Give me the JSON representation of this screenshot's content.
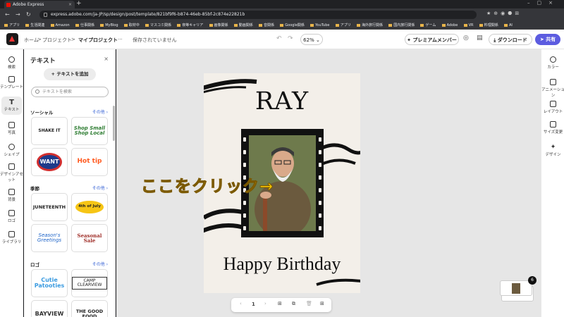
{
  "browser": {
    "tab_title": "Adobe Express",
    "url": "express.adobe.com/ja-JP/sp/design/post/template/821bf9f6-b874-46eb-85bf-2c874e22821b",
    "bookmarks": [
      "アプリ",
      "生活関連",
      "Amazon",
      "仕事関係",
      "MyBlog",
      "取材中",
      "マスコミ関係",
      "夜等キャリア",
      "画像関係",
      "動画関係",
      "音関係",
      "Google関係",
      "YouTube",
      "アプリ",
      "海外旅行関係",
      "国内旅行関係",
      "ゲーム",
      "Adobe",
      "VR",
      "料理関係",
      "AI"
    ]
  },
  "header": {
    "home": "ホーム",
    "sep1": ">",
    "project": "プロジェクト",
    "sep2": ">",
    "myproject": "マイプロジェクト",
    "menu": "···",
    "save_status": "保存されていません",
    "zoom": "62%",
    "premium": "プレミアムメンバー",
    "download": "ダウンロード",
    "share": "共有"
  },
  "leftrail": [
    "検索",
    "テンプレート",
    "テキスト",
    "写真",
    "シェイプ",
    "デザインアセット",
    "背景",
    "ロゴ",
    "ライブラリ"
  ],
  "panel": {
    "title": "テキスト",
    "close": "×",
    "add_text": "+ テキストを追加",
    "search_placeholder": "テキストを検索",
    "sections": [
      {
        "name": "ソーシャル",
        "more": "その他 ›",
        "tiles": [
          "SHAKE IT",
          "Shop Small Shop Local",
          "WANT",
          "Hot tip"
        ]
      },
      {
        "name": "季節",
        "more": "その他 ›",
        "tiles": [
          "JUNETEENTH",
          "4th of July",
          "Season's Greetings",
          "Seasonal Sale"
        ]
      },
      {
        "name": "ロゴ",
        "more": "その他 ›",
        "tiles": [
          "Cutie Patooties",
          "CAMP CLEARVIEW",
          "BAYVIEW",
          "THE GOOD FOOD"
        ]
      }
    ]
  },
  "card": {
    "title": "RAY",
    "subtitle": "Happy Birthday"
  },
  "annotation": "ここをクリック→",
  "bottombar": {
    "prev": "‹",
    "page": "1",
    "next": "›"
  },
  "rightrail": [
    "カラー",
    "アニメーション",
    "レイアウト",
    "サイズ変更",
    "デザイン"
  ],
  "page_count": "6"
}
